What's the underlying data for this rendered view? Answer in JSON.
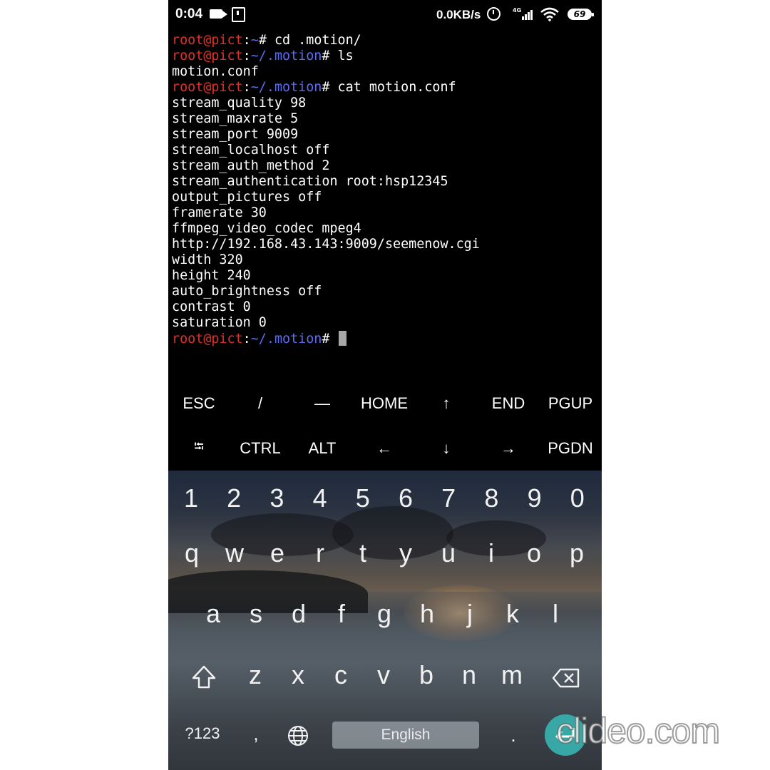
{
  "status_bar": {
    "time": "0:04",
    "network_speed": "0.0KB/s",
    "network_type": "4G",
    "battery": "69",
    "icons": [
      "video-record-icon",
      "notification-icon",
      "alarm-icon",
      "signal-icon",
      "wifi-icon",
      "battery-icon"
    ]
  },
  "terminal": {
    "prompt": {
      "user_host": "root@pict",
      "colon": ":",
      "home_path": "~",
      "motion_path": "~/.motion"
    },
    "lines": [
      {
        "type": "prompt",
        "path": "~",
        "symbol": "#",
        "command": " cd .motion/"
      },
      {
        "type": "prompt",
        "path": "~/.motion",
        "symbol": "#",
        "command": " ls"
      },
      {
        "type": "output",
        "text": "motion.conf"
      },
      {
        "type": "prompt",
        "path": "~/.motion",
        "symbol": "#",
        "command": " cat motion.conf"
      },
      {
        "type": "output",
        "text": "stream_quality 98"
      },
      {
        "type": "output",
        "text": "stream_maxrate 5"
      },
      {
        "type": "output",
        "text": "stream_port 9009"
      },
      {
        "type": "output",
        "text": "stream_localhost off"
      },
      {
        "type": "output",
        "text": "stream_auth_method 2"
      },
      {
        "type": "output",
        "text": "stream_authentication root:hsp12345"
      },
      {
        "type": "output",
        "text": "output_pictures off"
      },
      {
        "type": "output",
        "text": "framerate 30"
      },
      {
        "type": "output",
        "text": "ffmpeg_video_codec mpeg4"
      },
      {
        "type": "output",
        "text": "http://192.168.43.143:9009/seemenow.cgi"
      },
      {
        "type": "output",
        "text": "width 320"
      },
      {
        "type": "output",
        "text": "height 240"
      },
      {
        "type": "output",
        "text": "auto_brightness off"
      },
      {
        "type": "output",
        "text": "contrast 0"
      },
      {
        "type": "output",
        "text": "saturation 0"
      },
      {
        "type": "prompt",
        "path": "~/.motion",
        "symbol": "#",
        "command": " ",
        "cursor": true
      }
    ]
  },
  "extra_keys": {
    "row1": [
      "ESC",
      "/",
      "—",
      "HOME",
      "↑",
      "END",
      "PGUP"
    ],
    "row2": [
      "⭾",
      "CTRL",
      "ALT",
      "←",
      "↓",
      "→",
      "PGDN"
    ]
  },
  "keyboard": {
    "numbers": [
      "1",
      "2",
      "3",
      "4",
      "5",
      "6",
      "7",
      "8",
      "9",
      "0"
    ],
    "row1": [
      "q",
      "w",
      "e",
      "r",
      "t",
      "y",
      "u",
      "i",
      "o",
      "p"
    ],
    "row2": [
      "a",
      "s",
      "d",
      "f",
      "g",
      "h",
      "j",
      "k",
      "l"
    ],
    "row3": [
      "z",
      "x",
      "c",
      "v",
      "b",
      "n",
      "m"
    ],
    "symbols_label": "?123",
    "comma": ",",
    "space_label": "English",
    "period": "."
  },
  "watermark": "clideo.com"
}
